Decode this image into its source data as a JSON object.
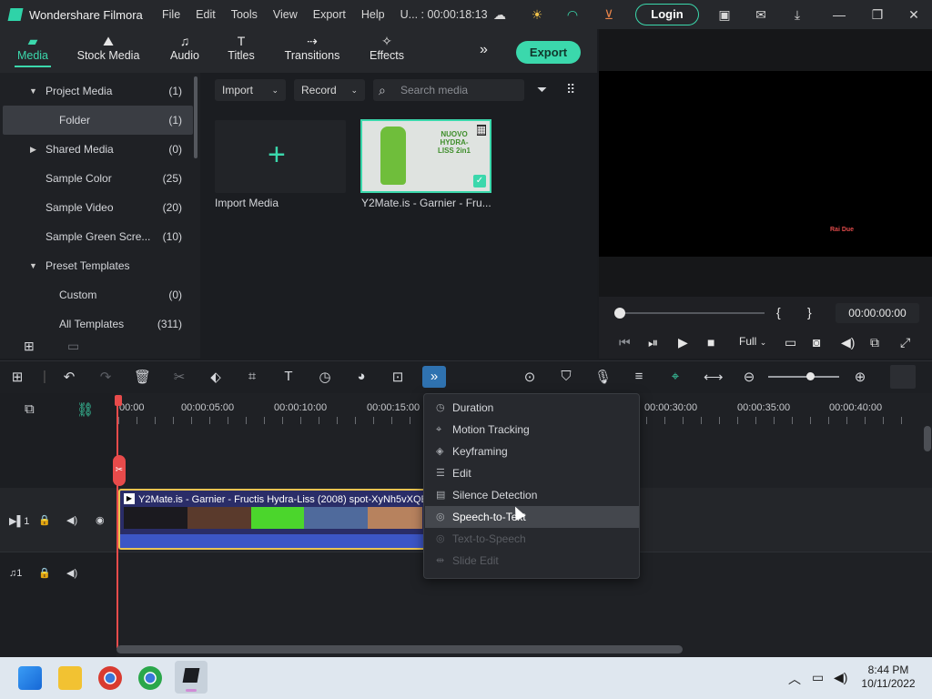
{
  "titlebar": {
    "app_title": "Wondershare Filmora",
    "menu": [
      "File",
      "Edit",
      "Tools",
      "View",
      "Export",
      "Help"
    ],
    "project_timecode": "U... : 00:00:18:13",
    "login_label": "Login"
  },
  "tabs": [
    {
      "label": "Media",
      "icon": "media-icon",
      "active": true
    },
    {
      "label": "Stock Media",
      "icon": "stock-media-icon",
      "active": false
    },
    {
      "label": "Audio",
      "icon": "audio-icon",
      "active": false
    },
    {
      "label": "Titles",
      "icon": "titles-icon",
      "active": false
    },
    {
      "label": "Transitions",
      "icon": "transitions-icon",
      "active": false
    },
    {
      "label": "Effects",
      "icon": "effects-icon",
      "active": false
    }
  ],
  "export_label": "Export",
  "library": [
    {
      "label": "Project Media",
      "count": "(1)",
      "caret": "down"
    },
    {
      "label": "Folder",
      "count": "(1)",
      "selected": true
    },
    {
      "label": "Shared Media",
      "count": "(0)",
      "caret": "right"
    },
    {
      "label": "Sample Color",
      "count": "(25)"
    },
    {
      "label": "Sample Video",
      "count": "(20)"
    },
    {
      "label": "Sample Green Scre...",
      "count": "(10)"
    },
    {
      "label": "Preset Templates",
      "count": "",
      "caret": "down"
    },
    {
      "label": "Custom",
      "count": "(0)"
    },
    {
      "label": "All Templates",
      "count": "(311)"
    }
  ],
  "mediabar": {
    "import_label": "Import",
    "record_label": "Record",
    "search_placeholder": "Search media"
  },
  "media_items": {
    "import_caption": "Import Media",
    "clip_caption": "Y2Mate.is - Garnier - Fru...",
    "thumb_text": "NUOVO HYDRA-LISS 2in1"
  },
  "preview": {
    "timecode": "00:00:00:00",
    "quality": "Full",
    "watermark": "Rai Due"
  },
  "ruler_ticks": [
    "00:00",
    "00:00:05:00",
    "00:00:10:00",
    "00:00:15:00",
    "00:00:30:00",
    "00:00:35:00",
    "00:00:40:00"
  ],
  "clip_title": "Y2Mate.is - Garnier - Fructis Hydra-Liss (2008) spot-XyNh5vXQE",
  "tracks": {
    "video": "1",
    "audio": "1"
  },
  "context_menu": [
    {
      "label": "Duration",
      "icon": "clock-icon",
      "state": "normal"
    },
    {
      "label": "Motion Tracking",
      "icon": "motion-tracking-icon",
      "state": "normal"
    },
    {
      "label": "Keyframing",
      "icon": "keyframe-icon",
      "state": "normal"
    },
    {
      "label": "Edit",
      "icon": "sliders-icon",
      "state": "normal"
    },
    {
      "label": "Silence Detection",
      "icon": "silence-icon",
      "state": "normal"
    },
    {
      "label": "Speech-to-Text",
      "icon": "speech-icon",
      "state": "hover"
    },
    {
      "label": "Text-to-Speech",
      "icon": "tts-icon",
      "state": "disabled"
    },
    {
      "label": "Slide Edit",
      "icon": "slide-icon",
      "state": "disabled"
    }
  ],
  "taskbar": {
    "time": "8:44 PM",
    "date": "10/11/2022"
  },
  "colors": {
    "accent": "#3bd8ac",
    "clip_border": "#e9c451",
    "playhead": "#e84b4b"
  }
}
